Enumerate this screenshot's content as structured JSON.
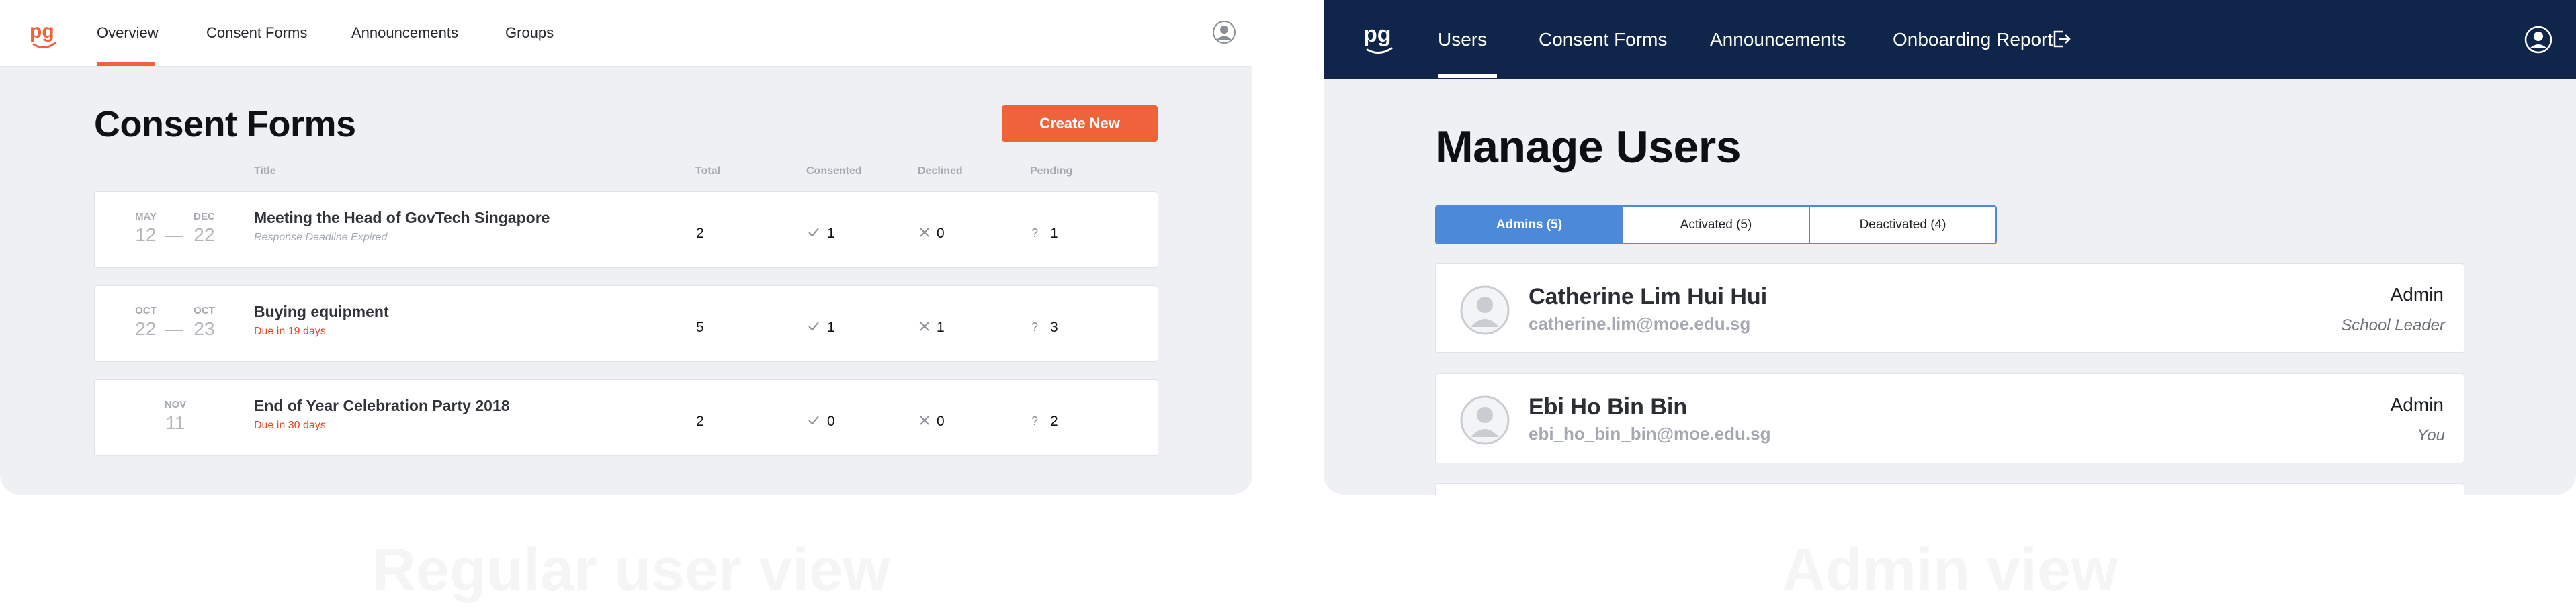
{
  "regular_view": {
    "nav": {
      "items": [
        {
          "label": "Overview",
          "active": true
        },
        {
          "label": "Consent Forms"
        },
        {
          "label": "Announcements"
        },
        {
          "label": "Groups"
        }
      ]
    },
    "page_title": "Consent Forms",
    "create_button": "Create New",
    "columns": {
      "title": "Title",
      "total": "Total",
      "consented": "Consented",
      "declined": "Declined",
      "pending": "Pending"
    },
    "forms": [
      {
        "start_month": "MAY",
        "start_day": "12",
        "end_month": "DEC",
        "end_day": "22",
        "dash": "—",
        "title": "Meeting the Head of GovTech Singapore",
        "status": "Response Deadline Expired",
        "status_type": "expired",
        "total": "2",
        "consented": "1",
        "declined": "0",
        "pending": "1"
      },
      {
        "start_month": "OCT",
        "start_day": "22",
        "end_month": "OCT",
        "end_day": "23",
        "dash": "—",
        "title": "Buying equipment",
        "status": "Due in 19 days",
        "status_type": "due",
        "total": "5",
        "consented": "1",
        "declined": "1",
        "pending": "3"
      },
      {
        "start_month": "NOV",
        "start_day": "11",
        "title": "End of Year Celebration Party 2018",
        "status": "Due in 30 days",
        "status_type": "due",
        "total": "2",
        "consented": "0",
        "declined": "0",
        "pending": "2"
      }
    ],
    "icons": {
      "consented": "check-icon",
      "declined": "cross-icon",
      "pending": "question-icon"
    },
    "accent_color": "#ef633b",
    "caption": "Regular user view"
  },
  "admin_view": {
    "nav": {
      "items": [
        {
          "label": "Users",
          "active": true
        },
        {
          "label": "Consent Forms"
        },
        {
          "label": "Announcements"
        },
        {
          "label": "Onboarding Report"
        }
      ]
    },
    "page_title": "Manage Users",
    "tabs": [
      {
        "label": "Admins (5)",
        "active": true
      },
      {
        "label": "Activated (5)"
      },
      {
        "label": "Deactivated (4)"
      }
    ],
    "users": [
      {
        "name": "Catherine Lim Hui Hui",
        "email": "catherine.lim@moe.edu.sg",
        "role": "Admin",
        "sub": "School Leader"
      },
      {
        "name": "Ebi Ho Bin Bin",
        "email": "ebi_ho_bin_bin@moe.edu.sg",
        "role": "Admin",
        "sub": "You"
      }
    ],
    "nav_color": "#0f2549",
    "tab_color": "#4d89d9",
    "caption": "Admin view"
  }
}
